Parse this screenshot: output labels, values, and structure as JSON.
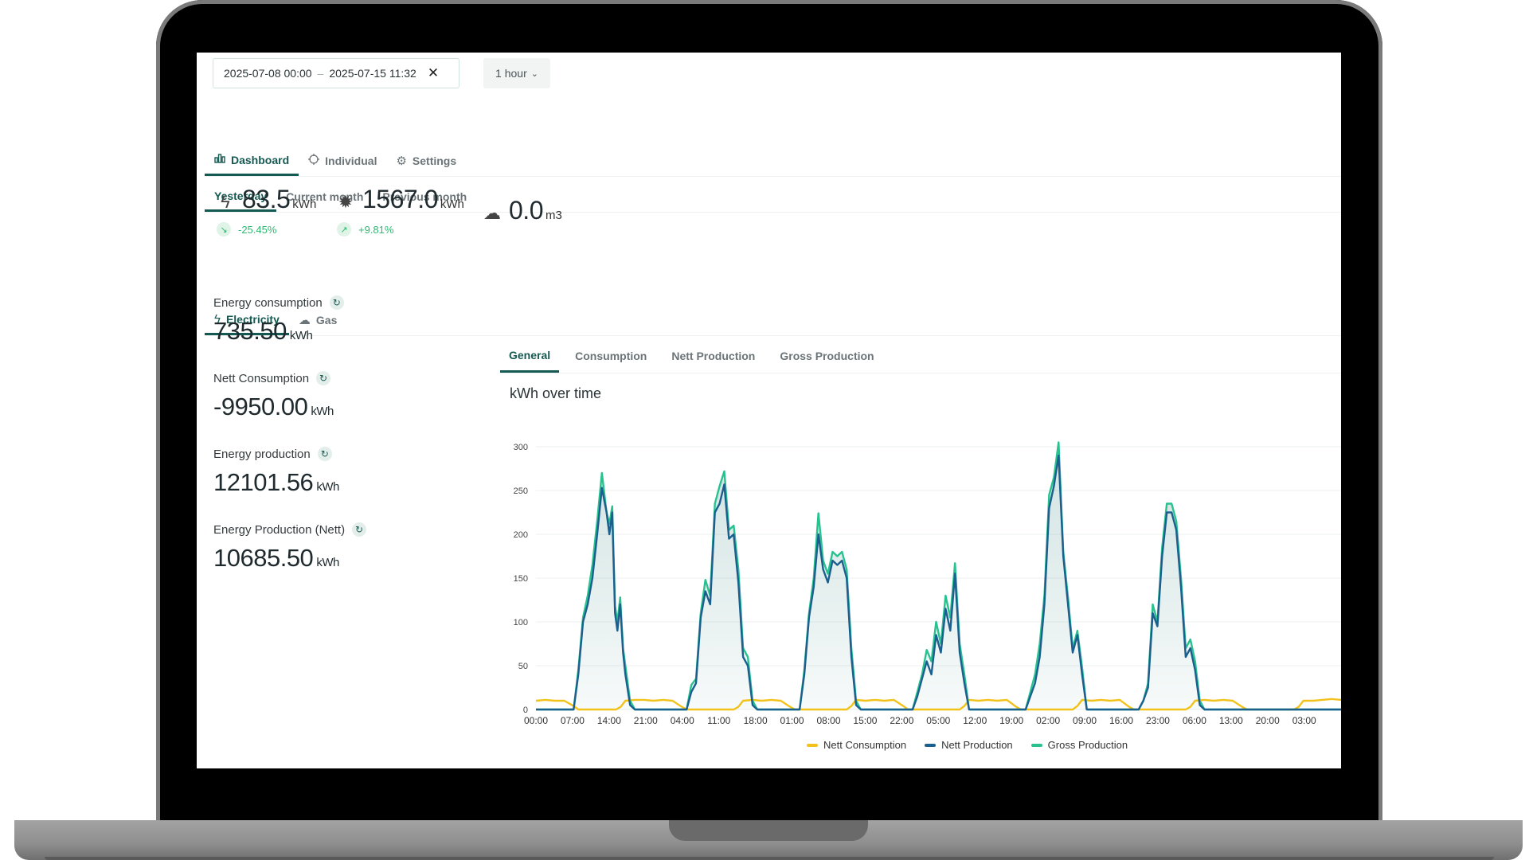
{
  "filters": {
    "date_from": "2025-07-08 00:00",
    "date_sep": "–",
    "date_to": "2025-07-15 11:32",
    "clear_icon": "close-icon",
    "interval": "1 hour"
  },
  "main_tabs": [
    {
      "label": "Dashboard",
      "icon": "bar-chart-icon",
      "active": true
    },
    {
      "label": "Individual",
      "icon": "crosshair-icon",
      "active": false
    },
    {
      "label": "Settings",
      "icon": "gear-icon",
      "active": false
    }
  ],
  "period_tabs": [
    {
      "label": "Yesterday",
      "active": true
    },
    {
      "label": "Current month",
      "active": false
    },
    {
      "label": "Previous month",
      "active": false
    }
  ],
  "summary": {
    "electricity": {
      "value": "83.5",
      "unit": "kWh",
      "delta": "-25.45%",
      "icon": "lightning-icon"
    },
    "solar": {
      "value": "1567.0",
      "unit": "kWh",
      "delta": "+9.81%",
      "icon": "sun-icon"
    },
    "gas": {
      "value": "0.0",
      "unit": "m3",
      "icon": "cloud-icon"
    }
  },
  "energy_tabs": [
    {
      "label": "Electricity",
      "icon": "lightning-icon",
      "active": true
    },
    {
      "label": "Gas",
      "icon": "cloud-icon",
      "active": false
    }
  ],
  "kpis": [
    {
      "label": "Energy consumption",
      "value": "735.50",
      "unit": "kWh"
    },
    {
      "label": "Nett Consumption",
      "value": "-9950.00",
      "unit": "kWh"
    },
    {
      "label": "Energy production",
      "value": "12101.56",
      "unit": "kWh"
    },
    {
      "label": "Energy Production (Nett)",
      "value": "10685.50",
      "unit": "kWh"
    }
  ],
  "chart_tabs": [
    {
      "label": "General",
      "active": true
    },
    {
      "label": "Consumption",
      "active": false
    },
    {
      "label": "Nett Production",
      "active": false
    },
    {
      "label": "Gross Production",
      "active": false
    }
  ],
  "colors": {
    "accent": "#155a52",
    "nett_consumption": "#f2c21a",
    "nett_production": "#1b5f8f",
    "gross_production": "#27c28f"
  },
  "chart_data": {
    "type": "line",
    "title": "kWh over time",
    "y_ticks": [
      0,
      50,
      100,
      150,
      200,
      250,
      300
    ],
    "ylim": [
      0,
      300
    ],
    "x_tick_labels": [
      "00:00",
      "07:00",
      "14:00",
      "21:00",
      "04:00",
      "11:00",
      "18:00",
      "01:00",
      "08:00",
      "15:00",
      "22:00",
      "05:00",
      "12:00",
      "19:00",
      "02:00",
      "09:00",
      "16:00",
      "23:00",
      "06:00",
      "13:00",
      "20:00",
      "03:00"
    ],
    "x_hours_range": [
      0,
      171
    ],
    "grid": true,
    "legend_position": "bottom",
    "series": [
      {
        "name": "Nett Consumption",
        "points": [
          [
            0,
            10
          ],
          [
            2,
            11
          ],
          [
            4,
            10
          ],
          [
            6,
            10
          ],
          [
            8,
            4
          ],
          [
            9,
            0
          ],
          [
            17,
            0
          ],
          [
            18,
            3
          ],
          [
            19,
            10
          ],
          [
            21,
            11
          ],
          [
            23,
            11
          ],
          [
            25,
            10
          ],
          [
            27,
            11
          ],
          [
            29,
            10
          ],
          [
            31,
            3
          ],
          [
            32,
            0
          ],
          [
            42,
            0
          ],
          [
            43,
            3
          ],
          [
            44,
            10
          ],
          [
            46,
            11
          ],
          [
            48,
            10
          ],
          [
            50,
            11
          ],
          [
            52,
            10
          ],
          [
            54,
            3
          ],
          [
            55,
            0
          ],
          [
            66,
            0
          ],
          [
            67,
            4
          ],
          [
            68,
            11
          ],
          [
            70,
            10
          ],
          [
            72,
            11
          ],
          [
            74,
            10
          ],
          [
            76,
            11
          ],
          [
            78,
            4
          ],
          [
            79,
            0
          ],
          [
            90,
            0
          ],
          [
            91,
            4
          ],
          [
            92,
            11
          ],
          [
            94,
            10
          ],
          [
            96,
            11
          ],
          [
            98,
            10
          ],
          [
            100,
            11
          ],
          [
            102,
            3
          ],
          [
            103,
            0
          ],
          [
            114,
            0
          ],
          [
            115,
            4
          ],
          [
            116,
            11
          ],
          [
            118,
            10
          ],
          [
            120,
            11
          ],
          [
            122,
            10
          ],
          [
            124,
            11
          ],
          [
            126,
            3
          ],
          [
            127,
            0
          ],
          [
            138,
            0
          ],
          [
            139,
            3
          ],
          [
            140,
            10
          ],
          [
            142,
            11
          ],
          [
            144,
            10
          ],
          [
            146,
            11
          ],
          [
            148,
            10
          ],
          [
            150,
            3
          ],
          [
            151,
            0
          ],
          [
            161,
            0
          ],
          [
            162,
            3
          ],
          [
            163,
            10
          ],
          [
            165,
            10
          ],
          [
            167,
            11
          ],
          [
            169,
            12
          ],
          [
            171,
            11
          ]
        ]
      },
      {
        "name": "Nett Production",
        "points": [
          [
            0,
            0
          ],
          [
            8,
            0
          ],
          [
            9,
            40
          ],
          [
            10,
            100
          ],
          [
            11,
            120
          ],
          [
            12,
            150
          ],
          [
            13,
            200
          ],
          [
            14,
            253
          ],
          [
            15,
            225
          ],
          [
            15.6,
            200
          ],
          [
            16.2,
            225
          ],
          [
            16.8,
            110
          ],
          [
            17.3,
            90
          ],
          [
            17.9,
            120
          ],
          [
            18.5,
            65
          ],
          [
            19,
            40
          ],
          [
            20,
            5
          ],
          [
            21,
            0
          ],
          [
            32,
            0
          ],
          [
            33,
            20
          ],
          [
            34,
            30
          ],
          [
            35,
            105
          ],
          [
            36,
            135
          ],
          [
            37,
            120
          ],
          [
            38,
            225
          ],
          [
            39,
            235
          ],
          [
            40,
            257
          ],
          [
            41,
            195
          ],
          [
            42,
            200
          ],
          [
            43,
            145
          ],
          [
            44,
            60
          ],
          [
            45,
            50
          ],
          [
            46,
            5
          ],
          [
            47,
            0
          ],
          [
            56,
            0
          ],
          [
            57,
            40
          ],
          [
            58,
            105
          ],
          [
            59,
            140
          ],
          [
            60,
            200
          ],
          [
            61,
            160
          ],
          [
            62,
            145
          ],
          [
            63,
            170
          ],
          [
            64,
            165
          ],
          [
            65,
            170
          ],
          [
            66,
            150
          ],
          [
            67,
            60
          ],
          [
            68,
            5
          ],
          [
            69,
            0
          ],
          [
            80,
            0
          ],
          [
            81,
            15
          ],
          [
            82,
            35
          ],
          [
            83,
            55
          ],
          [
            84,
            40
          ],
          [
            85,
            85
          ],
          [
            86,
            65
          ],
          [
            87,
            115
          ],
          [
            88,
            90
          ],
          [
            89,
            155
          ],
          [
            90,
            65
          ],
          [
            91,
            30
          ],
          [
            92,
            0
          ],
          [
            104,
            0
          ],
          [
            105,
            15
          ],
          [
            106,
            30
          ],
          [
            107,
            60
          ],
          [
            108,
            120
          ],
          [
            109,
            230
          ],
          [
            110,
            255
          ],
          [
            111,
            290
          ],
          [
            112,
            175
          ],
          [
            113,
            120
          ],
          [
            114,
            65
          ],
          [
            115,
            85
          ],
          [
            116,
            40
          ],
          [
            117,
            0
          ],
          [
            128,
            0
          ],
          [
            129,
            10
          ],
          [
            130,
            25
          ],
          [
            131,
            110
          ],
          [
            132,
            95
          ],
          [
            133,
            175
          ],
          [
            134,
            225
          ],
          [
            135,
            225
          ],
          [
            136,
            205
          ],
          [
            137,
            140
          ],
          [
            138,
            60
          ],
          [
            139,
            70
          ],
          [
            140,
            45
          ],
          [
            141,
            5
          ],
          [
            142,
            0
          ],
          [
            171,
            0
          ]
        ]
      },
      {
        "name": "Gross Production",
        "points": [
          [
            0,
            0
          ],
          [
            8,
            0
          ],
          [
            9,
            45
          ],
          [
            10,
            105
          ],
          [
            11,
            130
          ],
          [
            12,
            165
          ],
          [
            13,
            215
          ],
          [
            14,
            270
          ],
          [
            15,
            225
          ],
          [
            15.6,
            212
          ],
          [
            16.2,
            232
          ],
          [
            16.8,
            118
          ],
          [
            17.3,
            100
          ],
          [
            17.9,
            128
          ],
          [
            18.5,
            70
          ],
          [
            19,
            50
          ],
          [
            20,
            10
          ],
          [
            21,
            0
          ],
          [
            32,
            0
          ],
          [
            33,
            28
          ],
          [
            34,
            35
          ],
          [
            35,
            110
          ],
          [
            36,
            148
          ],
          [
            37,
            130
          ],
          [
            38,
            235
          ],
          [
            39,
            255
          ],
          [
            40,
            272
          ],
          [
            41,
            205
          ],
          [
            42,
            210
          ],
          [
            43,
            160
          ],
          [
            44,
            70
          ],
          [
            45,
            60
          ],
          [
            46,
            10
          ],
          [
            47,
            0
          ],
          [
            56,
            0
          ],
          [
            57,
            45
          ],
          [
            58,
            110
          ],
          [
            59,
            150
          ],
          [
            60,
            224
          ],
          [
            61,
            170
          ],
          [
            62,
            155
          ],
          [
            63,
            180
          ],
          [
            64,
            175
          ],
          [
            65,
            180
          ],
          [
            66,
            160
          ],
          [
            67,
            70
          ],
          [
            68,
            10
          ],
          [
            69,
            0
          ],
          [
            80,
            0
          ],
          [
            81,
            20
          ],
          [
            82,
            40
          ],
          [
            83,
            68
          ],
          [
            84,
            55
          ],
          [
            85,
            100
          ],
          [
            86,
            75
          ],
          [
            87,
            130
          ],
          [
            88,
            105
          ],
          [
            89,
            167
          ],
          [
            90,
            75
          ],
          [
            91,
            40
          ],
          [
            92,
            0
          ],
          [
            104,
            0
          ],
          [
            105,
            20
          ],
          [
            106,
            40
          ],
          [
            107,
            75
          ],
          [
            108,
            130
          ],
          [
            109,
            245
          ],
          [
            110,
            265
          ],
          [
            111,
            305
          ],
          [
            112,
            180
          ],
          [
            113,
            128
          ],
          [
            114,
            70
          ],
          [
            115,
            90
          ],
          [
            116,
            48
          ],
          [
            117,
            0
          ],
          [
            128,
            0
          ],
          [
            129,
            10
          ],
          [
            130,
            30
          ],
          [
            131,
            120
          ],
          [
            132,
            100
          ],
          [
            133,
            185
          ],
          [
            134,
            235
          ],
          [
            135,
            235
          ],
          [
            136,
            215
          ],
          [
            137,
            150
          ],
          [
            138,
            70
          ],
          [
            139,
            80
          ],
          [
            140,
            55
          ],
          [
            141,
            10
          ],
          [
            142,
            0
          ],
          [
            171,
            0
          ]
        ]
      }
    ]
  }
}
